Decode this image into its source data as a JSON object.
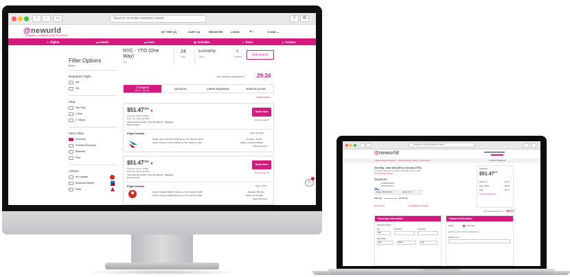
{
  "imac": {
    "browser": {
      "url_placeholder": "Search or enter website name"
    },
    "site": {
      "logo": "newurld",
      "tagline": "Congrats to CANADA GOLF PLAYERS",
      "nav": [
        "MY TRIP (0)",
        "CART (0)",
        "REGISTER",
        "LOGIN",
        "$ USD"
      ],
      "categories": [
        "Flights",
        "Hotels",
        "Cars",
        "Activities",
        "Tours",
        "Cruises"
      ]
    },
    "filters": {
      "title": "Filter Options",
      "reset": "Reset",
      "departure_heading": "Departure Flight",
      "departure_options": [
        "AM",
        "PM"
      ],
      "stop_heading": "Stop",
      "stop_options": [
        "Non Stop",
        "1 Stop",
        "2+ Stops"
      ],
      "fare_heading": "Fare Class",
      "fare_options": [
        "Economy",
        "Premium Economy",
        "Business",
        "First"
      ],
      "airlines_heading": "Airlines",
      "airline_options": [
        "Air Canada",
        "American Airlines",
        "Delta"
      ]
    },
    "search": {
      "route": "NYC - YTO (One Way)",
      "route_sub": "Edit",
      "date_day": "24",
      "date_sub": "Sept",
      "cabin": "Economy",
      "cabin_sub": "Cabin",
      "pax": "1",
      "pax_sub": "Traveler",
      "edit_button": "Edit Search",
      "timer_label": "Your session will expire in",
      "timer": "29:24"
    },
    "sort_tabs": [
      {
        "label": "Cheapest",
        "sub": "$51.47 · 8th 37m"
      },
      {
        "label": "Quickest",
        "sub": ""
      },
      {
        "label": "Latest Departure",
        "sub": ""
      },
      {
        "label": "Earliest Arrival",
        "sub": ""
      }
    ],
    "show_more": "Show More ›",
    "results": [
      {
        "price": "$51.47",
        "currency": "USD",
        "price_sub": "Price per person (USD)",
        "price_sub2": "Price incl. taxes and fees",
        "links": [
          "View Itinerary Details",
          "Price Breakdown",
          "Baggage"
        ],
        "refund": "Refund Policy",
        "book": "Book Now",
        "ref_link": "Rebook Fare ▼",
        "details_label": "Flight Details",
        "stops": "Stop: Non Stop",
        "depart": "Depart: New York (JFK) 8:05 am on Thu, Sept 24, 2020",
        "arrive": "Arrive: Toronto (YYZ) 11:45 am on Thu, Sept 24, 2020",
        "duration": "Duration: 3h 40m",
        "airline": "Airline: American Airlines",
        "class": "Class: Economy"
      },
      {
        "price": "$51.47",
        "currency": "USD",
        "price_sub": "Price per person (USD)",
        "price_sub2": "Price incl. taxes and fees",
        "links": [
          "View Itinerary Details",
          "Price Breakdown",
          "Baggage"
        ],
        "refund": "Refund Policy",
        "book": "Book Now",
        "ref_link": "Rebook Fare ▼",
        "details_label": "Flight Details",
        "stops": "Stop: 1 Stop",
        "depart": "Depart: Newark (EWR) 6:00 am on Thu, Sept 24, 2020",
        "arrive": "Arrive: Chicago (ORD) 8:01 am on Thu, Sept 24, 2020",
        "duration": "Duration: 8th 9hm",
        "airline": "Airline: Air Canada",
        "class": "Class: Economy"
      }
    ]
  },
  "macbook": {
    "browser": {
      "url_placeholder": "Search or enter website name"
    },
    "site": {
      "logo": "newurld",
      "steps": "1 Select Flight   2 Flight(s) ✓   3 Payment Information   4 Confirmation",
      "top_right": "FLIGHT DETAILS"
    },
    "trip": {
      "title": "One Way - New York (NY) to Toronto (YTO)",
      "sub": "Thursday, September 24, 2020 to Thursday, Sept 24, 2020",
      "link": "View Full Flight Details ›",
      "departure": "Departure:",
      "airline": "American Airlines",
      "class": "Class: Economy",
      "dep_info": "Depart: JFK 8:05 AM",
      "arr_info": "Arrival: YYZ",
      "dep_time": "8:05 am",
      "arr_time": "11:45 am",
      "refund_link": "Refund Policy",
      "baggage_link": "View Baggage Information"
    },
    "summary": {
      "label": "Total Price",
      "price": "$51.47",
      "currency": "USD",
      "rows": [
        [
          "Flight Cost",
          "$41.47"
        ],
        [
          "Taxes & Fees",
          "$10.00"
        ],
        [
          "Total",
          "$51.47"
        ]
      ],
      "link": "View Price Breakdown"
    },
    "timer_label": "Your session will expire in",
    "timer": "29:17",
    "passenger_panel": {
      "title": "Passenger Information",
      "sub": "Passenger Adult 1",
      "labels": [
        "Title",
        "First Name",
        "Last Name"
      ],
      "title_value": "Mrs.",
      "dob": "Date of Birth",
      "dob_values": [
        "Day",
        "Month",
        "Year"
      ]
    },
    "payment_panel": {
      "title": "Payment Information",
      "pay_by": "Pay By",
      "card": "Credit Card",
      "notice": "This is a secure and encrypted payment",
      "address": "Address Line 1"
    }
  }
}
